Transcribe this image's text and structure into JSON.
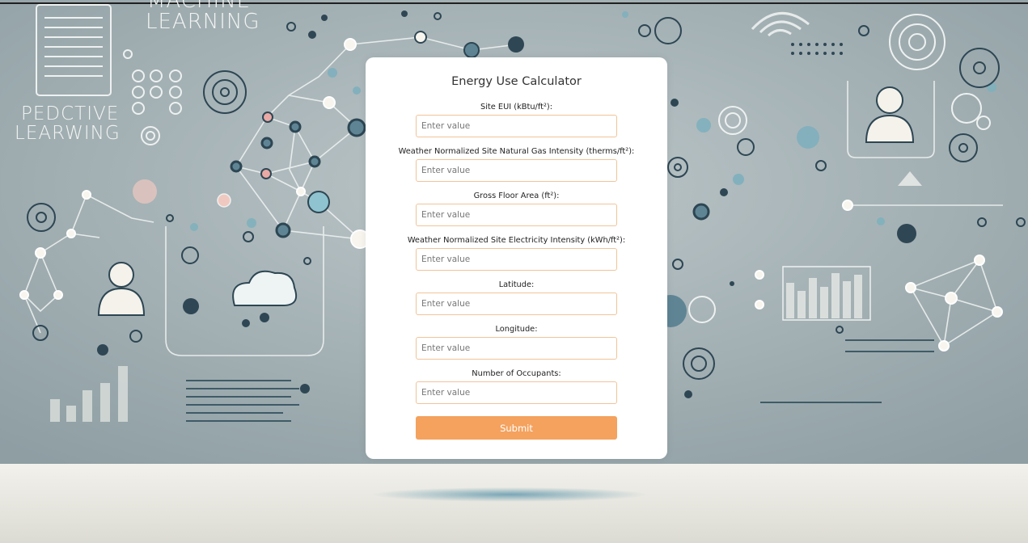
{
  "background": {
    "headline_top": "MACHINE",
    "headline_bottom": "LEARNING",
    "side_line1": "PEDCTIVE",
    "side_line2": "LEARWING"
  },
  "form": {
    "title": "Energy Use Calculator",
    "fields": [
      {
        "label": "Site EUI (kBtu/ft²):",
        "placeholder": "Enter value"
      },
      {
        "label": "Weather Normalized Site Natural Gas Intensity (therms/ft²):",
        "placeholder": "Enter value"
      },
      {
        "label": "Gross Floor Area (ft²):",
        "placeholder": "Enter value"
      },
      {
        "label": "Weather Normalized Site Electricity Intensity (kWh/ft²):",
        "placeholder": "Enter value"
      },
      {
        "label": "Latitude:",
        "placeholder": "Enter value"
      },
      {
        "label": "Longitude:",
        "placeholder": "Enter value"
      },
      {
        "label": "Number of Occupants:",
        "placeholder": "Enter value"
      }
    ],
    "submit_label": "Submit"
  },
  "colors": {
    "accent": "#f4a25e",
    "input_border": "#f0c49a",
    "background": "#a9b5b8"
  }
}
